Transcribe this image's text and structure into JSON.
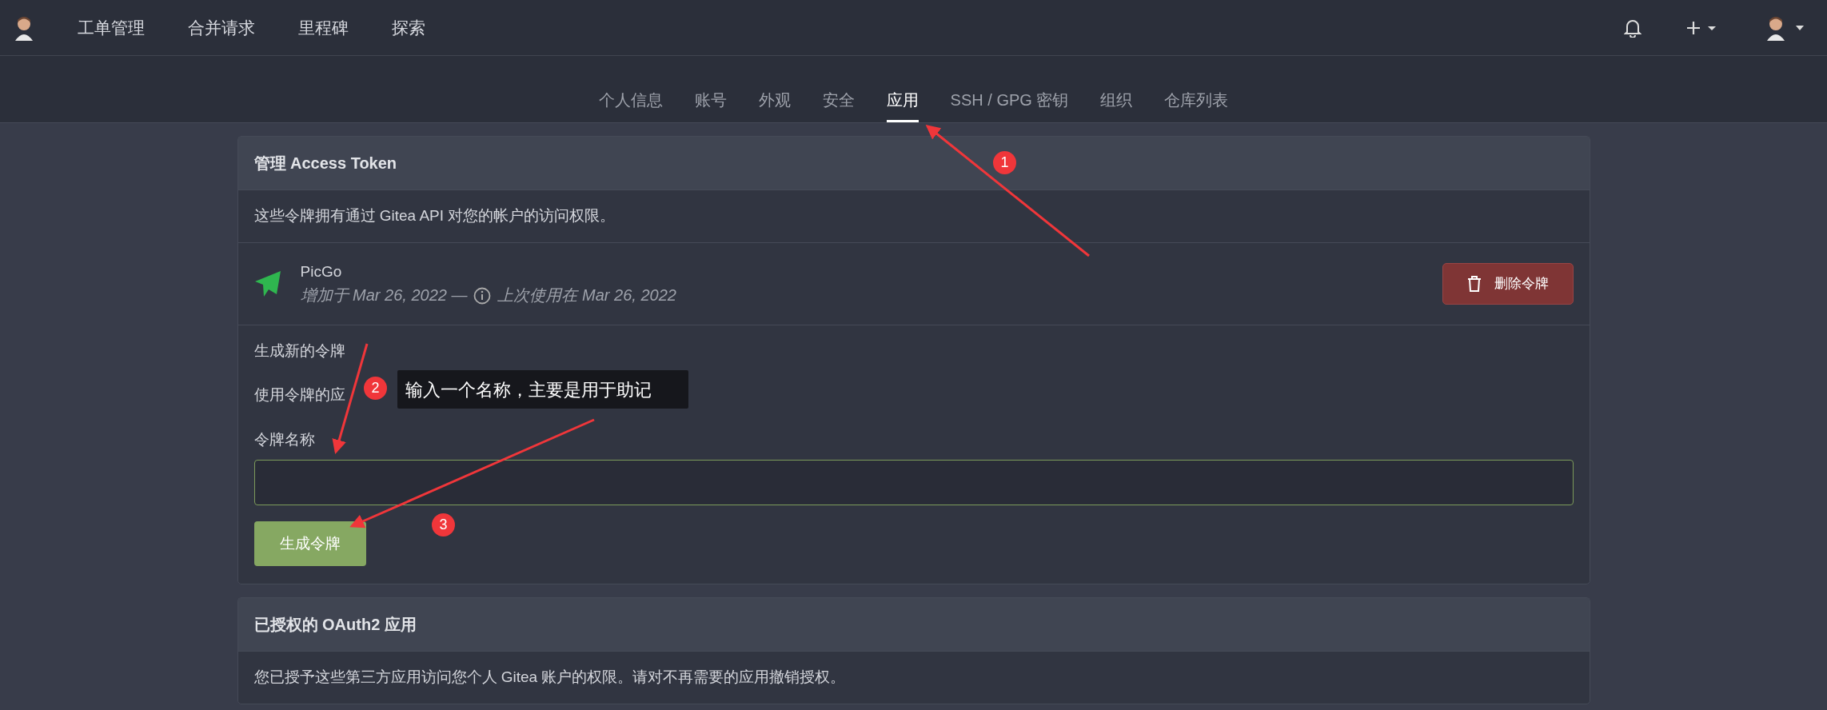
{
  "navbar": {
    "items": [
      {
        "label": "工单管理"
      },
      {
        "label": "合并请求"
      },
      {
        "label": "里程碑"
      },
      {
        "label": "探索"
      }
    ]
  },
  "settings_tabs": [
    {
      "label": "个人信息",
      "selected": false
    },
    {
      "label": "账号",
      "selected": false
    },
    {
      "label": "外观",
      "selected": false
    },
    {
      "label": "安全",
      "selected": false
    },
    {
      "label": "应用",
      "selected": true
    },
    {
      "label": "SSH / GPG 密钥",
      "selected": false
    },
    {
      "label": "组织",
      "selected": false
    },
    {
      "label": "仓库列表",
      "selected": false
    }
  ],
  "access_tokens": {
    "title": "管理 Access Token",
    "description": "这些令牌拥有通过 Gitea API 对您的帐户的访问权限。",
    "tokens": [
      {
        "name": "PicGo",
        "added": "增加于 Mar 26, 2022 —",
        "last_used": "上次使用在 Mar 26, 2022",
        "delete_label": "删除令牌"
      }
    ],
    "generate": {
      "title": "生成新的令牌",
      "hint": "使用令牌的应",
      "field_label": "令牌名称",
      "button": "生成令牌"
    }
  },
  "oauth2": {
    "title": "已授权的 OAuth2 应用",
    "description": "您已授予这些第三方应用访问您个人 Gitea 账户的权限。请对不再需要的应用撤销授权。"
  },
  "annotations": {
    "markers": [
      {
        "label": "1"
      },
      {
        "label": "2"
      },
      {
        "label": "3"
      }
    ],
    "tooltip": "输入一个名称，主要是用于助记"
  }
}
